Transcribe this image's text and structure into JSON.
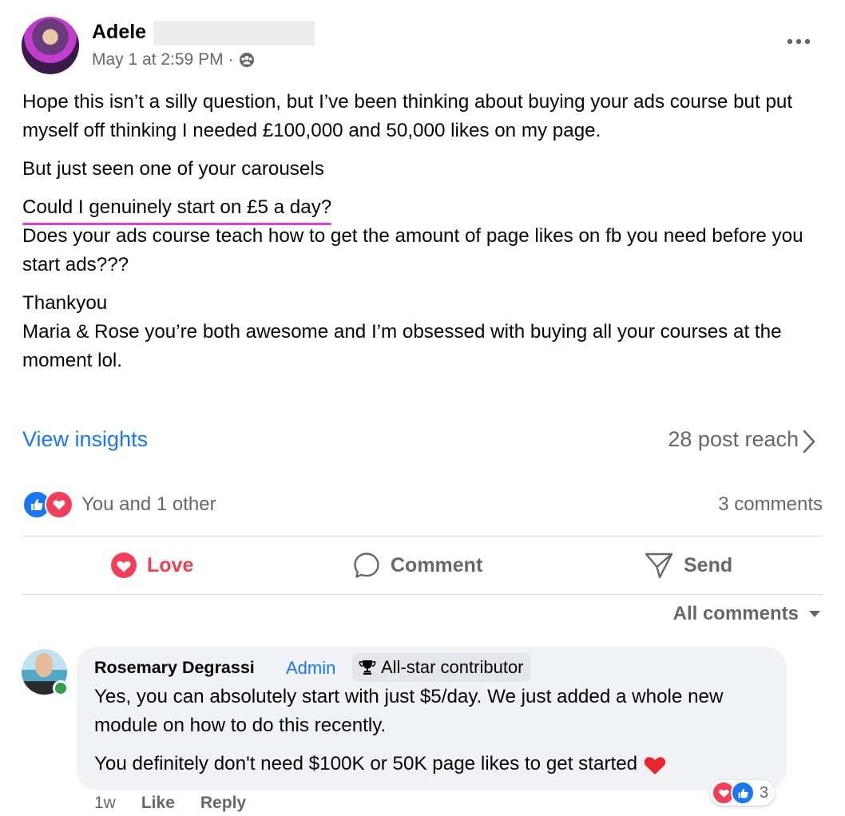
{
  "post": {
    "author": "Adele",
    "timestamp": "May 1 at 2:59 PM",
    "separator": "·",
    "privacy_icon": "group-icon",
    "paragraphs": [
      "Hope this isn’t a silly question, but I’ve been thinking about buying your ads course but put myself off thinking I needed £100,000 and 50,000 likes on my page.",
      "But just seen one of your carousels"
    ],
    "highlighted_line": "Could I genuinely start on £5 a day?",
    "after_highlight": "Does your ads course teach how to get the amount of page likes on fb you need before you start ads???",
    "closing_line1": "Thankyou",
    "closing_line2": "Maria & Rose you’re both awesome and I’m obsessed with buying all your courses at the moment lol.",
    "highlight_color": "#e23be0"
  },
  "insights": {
    "link_label": "View insights",
    "reach_label": "28 post reach"
  },
  "reactions": {
    "summary": "You and 1 other",
    "comments_count": "3 comments"
  },
  "actions": {
    "love": "Love",
    "comment": "Comment",
    "send": "Send"
  },
  "comments_filter": "All comments",
  "comment": {
    "author": "Rosemary Degrassi",
    "role": "Admin",
    "badge": "All-star contributor",
    "line1": "Yes, you can absolutely start with just $5/day. We just added a whole new module on how to do this recently.",
    "line2": "You definitely don't need $100K or 50K page likes to get started",
    "age": "1w",
    "like": "Like",
    "reply": "Reply",
    "reaction_count": "3"
  },
  "colors": {
    "link_blue": "#1877f2",
    "love_red": "#f33e58",
    "muted": "#65676b",
    "bubble_bg": "#f0f2f5"
  }
}
